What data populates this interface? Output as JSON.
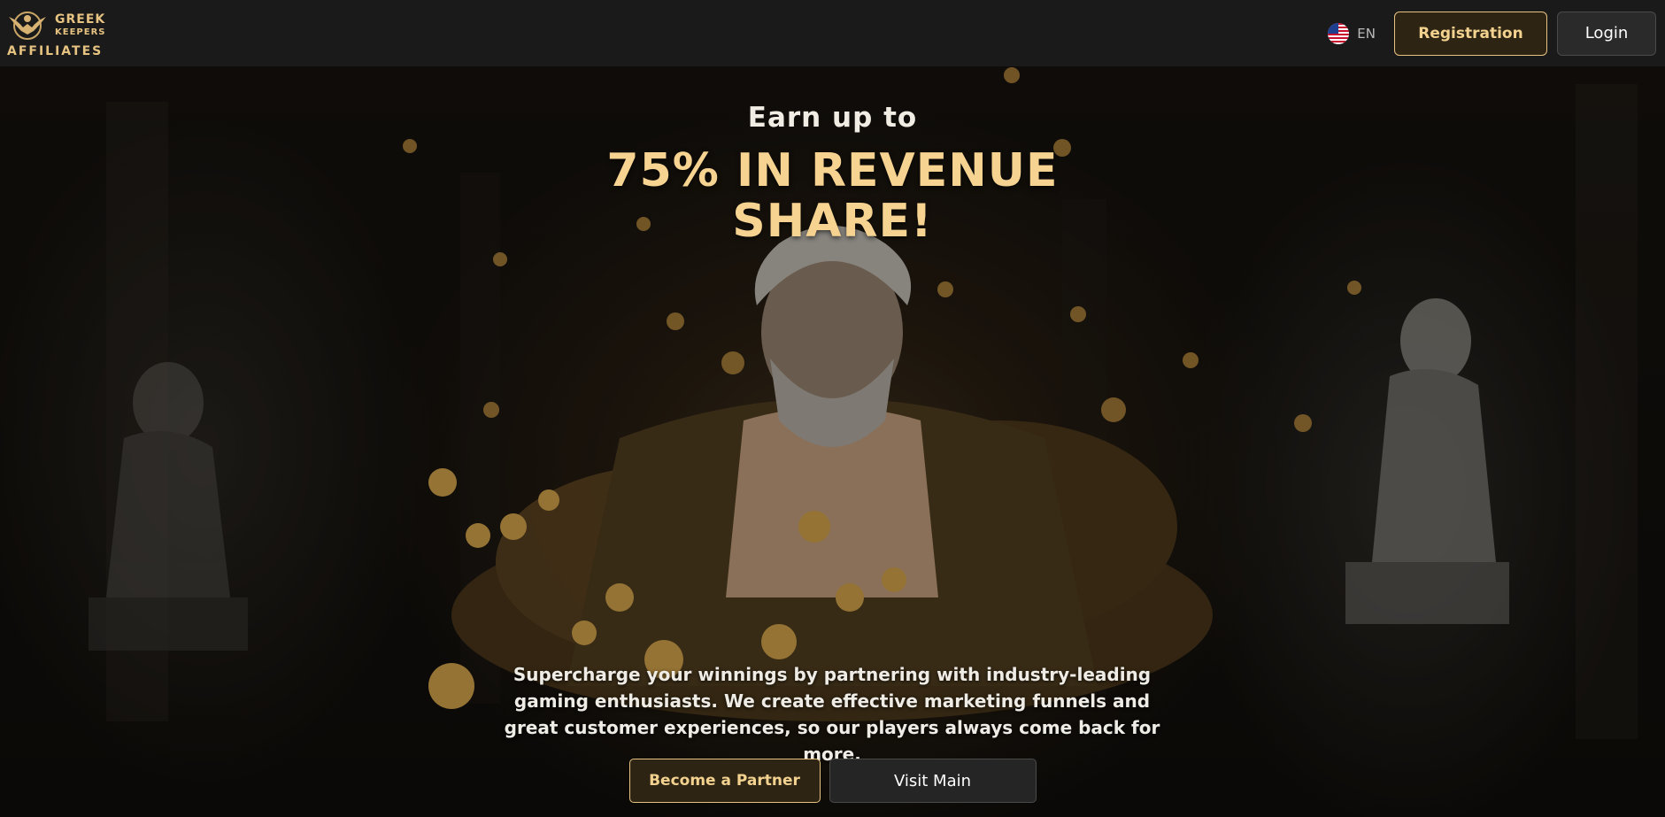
{
  "brand": {
    "line1": "GREEK",
    "line2": "KEEPERS",
    "line3": "AFFILIATES",
    "icon": "eagle-logo-icon"
  },
  "nav": {
    "language": {
      "label": "EN",
      "flag_icon": "us-flag-icon"
    },
    "registration_label": "Registration",
    "login_label": "Login"
  },
  "hero": {
    "eyebrow": "Earn up to",
    "headline": "75% IN REVENUE SHARE!",
    "description": "Supercharge your winnings by partnering with industry-leading gaming enthusiasts. We create effective marketing funnels and great customer experiences, so our players always come back for more.",
    "primary_cta": "Become a Partner",
    "secondary_cta": "Visit Main"
  },
  "colors": {
    "accent_gold": "#e7c382",
    "headline_gold": "#f6d391",
    "topbar_bg": "#1a1a1a",
    "page_bg": "#0d0c0a"
  }
}
